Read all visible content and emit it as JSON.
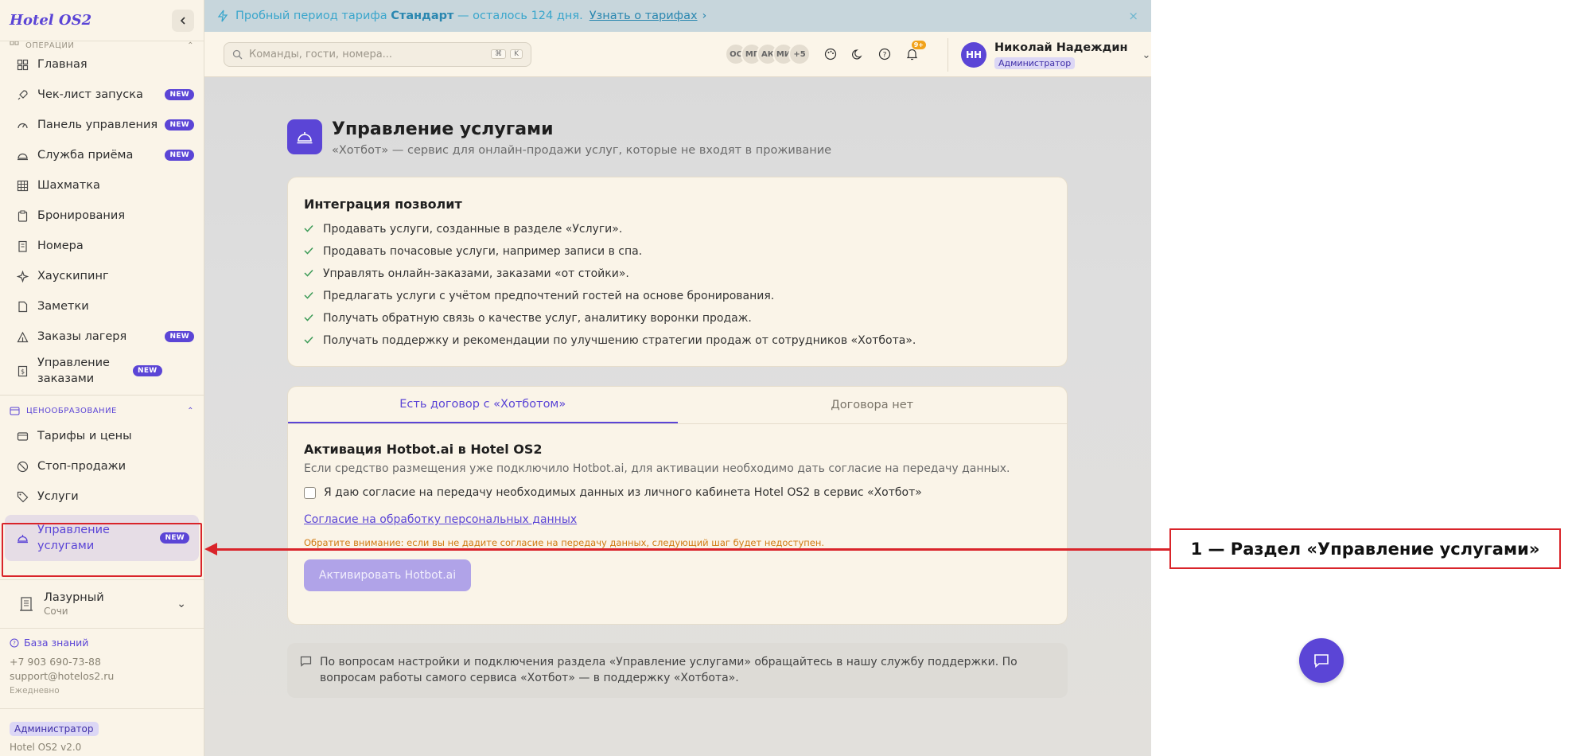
{
  "app": {
    "brand": "Hotel OS2"
  },
  "sidebar": {
    "ops_header": "ОПЕРАЦИИ",
    "ops_items": [
      {
        "label": "Главная",
        "icon": "grid-icon",
        "badge": ""
      },
      {
        "label": "Чек-лист запуска",
        "icon": "rocket-icon",
        "badge": "NEW"
      },
      {
        "label": "Панель управления",
        "icon": "gauge-icon",
        "badge": "NEW"
      },
      {
        "label": "Служба приёма",
        "icon": "concierge-bell-icon",
        "badge": "NEW"
      },
      {
        "label": "Шахматка",
        "icon": "table-icon",
        "badge": ""
      },
      {
        "label": "Бронирования",
        "icon": "clipboard-icon",
        "badge": ""
      },
      {
        "label": "Номера",
        "icon": "building-icon",
        "badge": ""
      },
      {
        "label": "Хаускипинг",
        "icon": "sparkles-icon",
        "badge": ""
      },
      {
        "label": "Заметки",
        "icon": "note-icon",
        "badge": ""
      },
      {
        "label": "Заказы лагеря",
        "icon": "tent-icon",
        "badge": "NEW"
      },
      {
        "label": "Управление заказами",
        "icon": "receipt-icon",
        "badge": "NEW"
      }
    ],
    "pricing_header": "ЦЕНООБРАЗОВАНИЕ",
    "pricing_items": [
      {
        "label": "Тарифы и цены",
        "icon": "wallet-icon",
        "badge": ""
      },
      {
        "label": "Стоп-продажи",
        "icon": "ban-icon",
        "badge": ""
      },
      {
        "label": "Услуги",
        "icon": "tag-icon",
        "badge": ""
      }
    ],
    "active_item": {
      "label": "Управление услугами",
      "badge": "NEW"
    },
    "property": {
      "name": "Лазурный",
      "city": "Сочи"
    },
    "support": {
      "kb_label": "База знаний",
      "phone": "+7 903 690-73-88",
      "email": "support@hotelos2.ru",
      "hours": "Ежедневно"
    },
    "footer": {
      "role": "Администратор",
      "version": "Hotel OS2 v2.0"
    }
  },
  "trial": {
    "prefix": "Пробный период тарифа",
    "plan": "Стандарт",
    "suffix": "— осталось 124 дня.",
    "link": "Узнать о тарифах",
    "close": "×"
  },
  "topbar": {
    "search_placeholder": "Команды, гости, номера...",
    "kbd1": "⌘",
    "kbd2": "K",
    "avatars": [
      "ОС",
      "МГ",
      "АК",
      "МИ",
      "+5"
    ],
    "notif_badge": "9+",
    "user": {
      "initials": "НН",
      "name": "Николай Надеждин",
      "role": "Администратор"
    }
  },
  "page": {
    "title": "Управление услугами",
    "subtitle": "«Хотбот» — сервис для онлайн-продажи услуг, которые не входят в проживание",
    "features_title": "Интеграция позволит",
    "features": [
      "Продавать услуги, созданные в разделе «Услуги».",
      "Продавать почасовые услуги, например записи в спа.",
      "Управлять онлайн-заказами, заказами «от стойки».",
      "Предлагать услуги с учётом предпочтений гостей на основе бронирования.",
      "Получать обратную связь о качестве услуг, аналитику воронки продаж.",
      "Получать поддержку и рекомендации по улучшению стратегии продаж от сотрудников «Хотбота»."
    ],
    "tabs": [
      "Есть договор с «Хотботом»",
      "Договора нет"
    ],
    "activation_title": "Активация Hotbot.ai в Hotel OS2",
    "activation_desc": "Если средство размещения уже подключило Hotbot.ai, для активации необходимо дать согласие на передачу данных.",
    "consent_text": "Я даю согласие на передачу необходимых данных из личного кабинета Hotel OS2 в сервис «Хотбот»",
    "privacy_link": "Согласие на обработку персональных данных",
    "warning": "Обратите внимание: если вы не дадите согласие на передачу данных, следующий шаг будет недоступен.",
    "activate_button": "Активировать Hotbot.ai",
    "help_text": "По вопросам настройки и подключения раздела «Управление услугами» обращайтесь в нашу службу поддержки. По вопросам работы самого сервиса «Хотбот» — в поддержку «Хотбота»."
  },
  "annotation": {
    "label": "1 — Раздел «Управление услугами»",
    "color": "#d9242a"
  }
}
